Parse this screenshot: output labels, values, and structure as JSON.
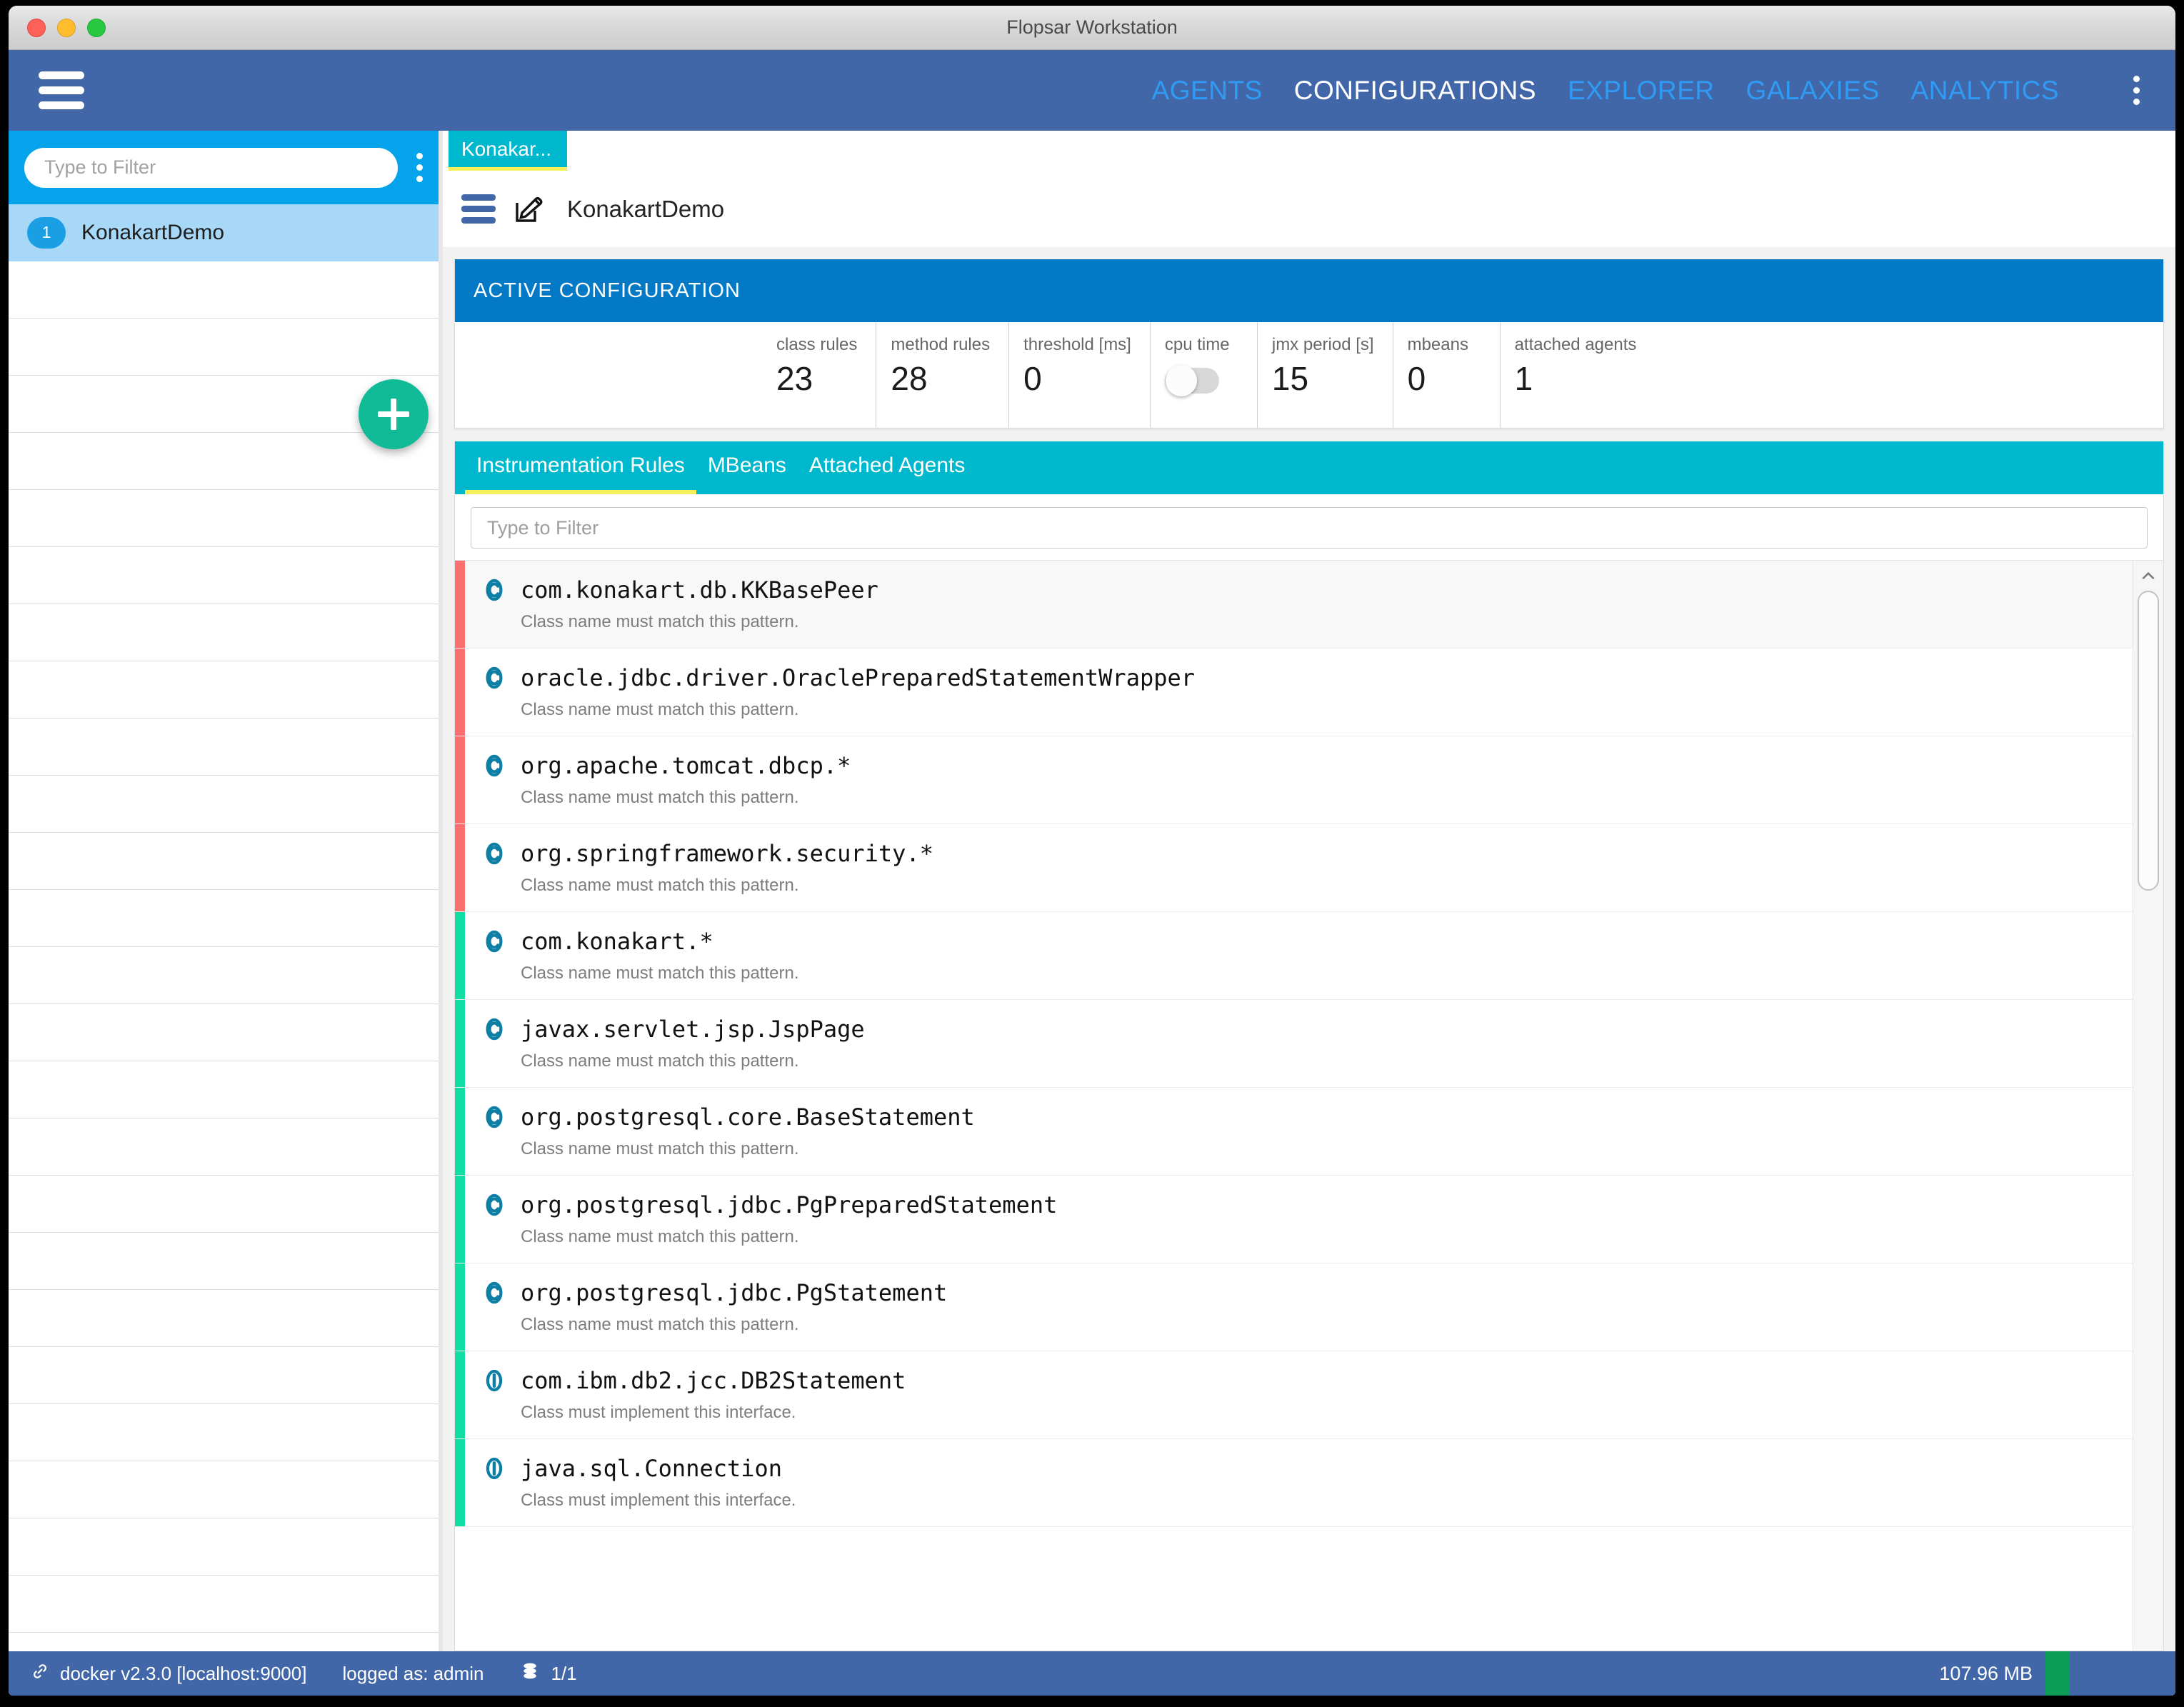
{
  "window": {
    "title": "Flopsar Workstation",
    "traffic_lights": [
      "close",
      "minimize",
      "zoom"
    ]
  },
  "navbar": {
    "menu_icon": "hamburger-icon",
    "overflow_icon": "kebab-menu-icon",
    "items": [
      {
        "label": "AGENTS",
        "active": false
      },
      {
        "label": "CONFIGURATIONS",
        "active": true
      },
      {
        "label": "EXPLORER",
        "active": false
      },
      {
        "label": "GALAXIES",
        "active": false
      },
      {
        "label": "ANALYTICS",
        "active": false
      }
    ],
    "colors": {
      "bar": "#4267a8",
      "inactive_text": "#2f9bf5",
      "active_text": "#ffffff"
    }
  },
  "sidebar": {
    "filter": {
      "value": "",
      "placeholder": "Type to Filter"
    },
    "overflow_icon": "kebab-menu-icon",
    "add_button_icon": "plus-icon",
    "items": [
      {
        "badge": "1",
        "label": "KonakartDemo",
        "selected": true
      }
    ],
    "empty_row_count": 25,
    "colors": {
      "filter_bar": "#04a3ec",
      "selected_row": "#a8d8f8",
      "badge": "#1a9fe5",
      "fab": "#12bb97"
    }
  },
  "document": {
    "tab_label": "Konakar...",
    "menu_icon": "hamburger-icon",
    "edit_icon": "edit-pencil-icon",
    "title": "KonakartDemo",
    "colors": {
      "tab_bg": "#00b8ce",
      "tab_underline": "#f5f05a"
    }
  },
  "active_configuration": {
    "heading": "ACTIVE CONFIGURATION",
    "heading_bg": "#0479c6",
    "stats": [
      {
        "label": "class rules",
        "value": "23",
        "type": "number"
      },
      {
        "label": "method rules",
        "value": "28",
        "type": "number"
      },
      {
        "label": "threshold [ms]",
        "value": "0",
        "type": "number"
      },
      {
        "label": "cpu time",
        "value": "off",
        "type": "toggle"
      },
      {
        "label": "jmx period [s]",
        "value": "15",
        "type": "number"
      },
      {
        "label": "mbeans",
        "value": "0",
        "type": "number"
      },
      {
        "label": "attached agents",
        "value": "1",
        "type": "number"
      }
    ]
  },
  "panel": {
    "tabs": [
      {
        "label": "Instrumentation Rules",
        "active": true
      },
      {
        "label": "MBeans",
        "active": false
      },
      {
        "label": "Attached Agents",
        "active": false
      }
    ],
    "filter": {
      "value": "",
      "placeholder": "Type to Filter"
    },
    "colors": {
      "tabs_bg": "#00b8ce",
      "tab_underline": "#f5f05a"
    },
    "scrollbar": {
      "up_arrow_icon": "chevron-up-icon",
      "thumb_position": "top"
    }
  },
  "rules": [
    {
      "name": "com.konakart.db.KKBasePeer",
      "desc": "Class name must match this pattern.",
      "kind": "class",
      "icon": "class-c-icon",
      "accent": "red",
      "highlighted": true
    },
    {
      "name": "oracle.jdbc.driver.OraclePreparedStatementWrapper",
      "desc": "Class name must match this pattern.",
      "kind": "class",
      "icon": "class-c-icon",
      "accent": "red",
      "highlighted": false
    },
    {
      "name": "org.apache.tomcat.dbcp.*",
      "desc": "Class name must match this pattern.",
      "kind": "class",
      "icon": "class-c-icon",
      "accent": "red",
      "highlighted": false
    },
    {
      "name": "org.springframework.security.*",
      "desc": "Class name must match this pattern.",
      "kind": "class",
      "icon": "class-c-icon",
      "accent": "red",
      "highlighted": false
    },
    {
      "name": "com.konakart.*",
      "desc": "Class name must match this pattern.",
      "kind": "class",
      "icon": "class-c-icon",
      "accent": "green",
      "highlighted": false
    },
    {
      "name": "javax.servlet.jsp.JspPage",
      "desc": "Class name must match this pattern.",
      "kind": "class",
      "icon": "class-c-icon",
      "accent": "green",
      "highlighted": false
    },
    {
      "name": "org.postgresql.core.BaseStatement",
      "desc": "Class name must match this pattern.",
      "kind": "class",
      "icon": "class-c-icon",
      "accent": "green",
      "highlighted": false
    },
    {
      "name": "org.postgresql.jdbc.PgPreparedStatement",
      "desc": "Class name must match this pattern.",
      "kind": "class",
      "icon": "class-c-icon",
      "accent": "green",
      "highlighted": false
    },
    {
      "name": "org.postgresql.jdbc.PgStatement",
      "desc": "Class name must match this pattern.",
      "kind": "class",
      "icon": "class-c-icon",
      "accent": "green",
      "highlighted": false
    },
    {
      "name": "com.ibm.db2.jcc.DB2Statement",
      "desc": "Class must implement this interface.",
      "kind": "interface",
      "icon": "interface-i-icon",
      "accent": "green",
      "highlighted": false
    },
    {
      "name": "java.sql.Connection",
      "desc": "Class must implement this interface.",
      "kind": "interface",
      "icon": "interface-i-icon",
      "accent": "green",
      "highlighted": false
    }
  ],
  "statusbar": {
    "connection_icon": "link-icon",
    "connection": "docker v2.3.0 [localhost:9000]",
    "user": "logged as: admin",
    "agents_icon": "stack-icon",
    "agents": "1/1",
    "memory": "107.96 MB",
    "heap_color": "#0a9e57",
    "bg": "#4267a8"
  }
}
